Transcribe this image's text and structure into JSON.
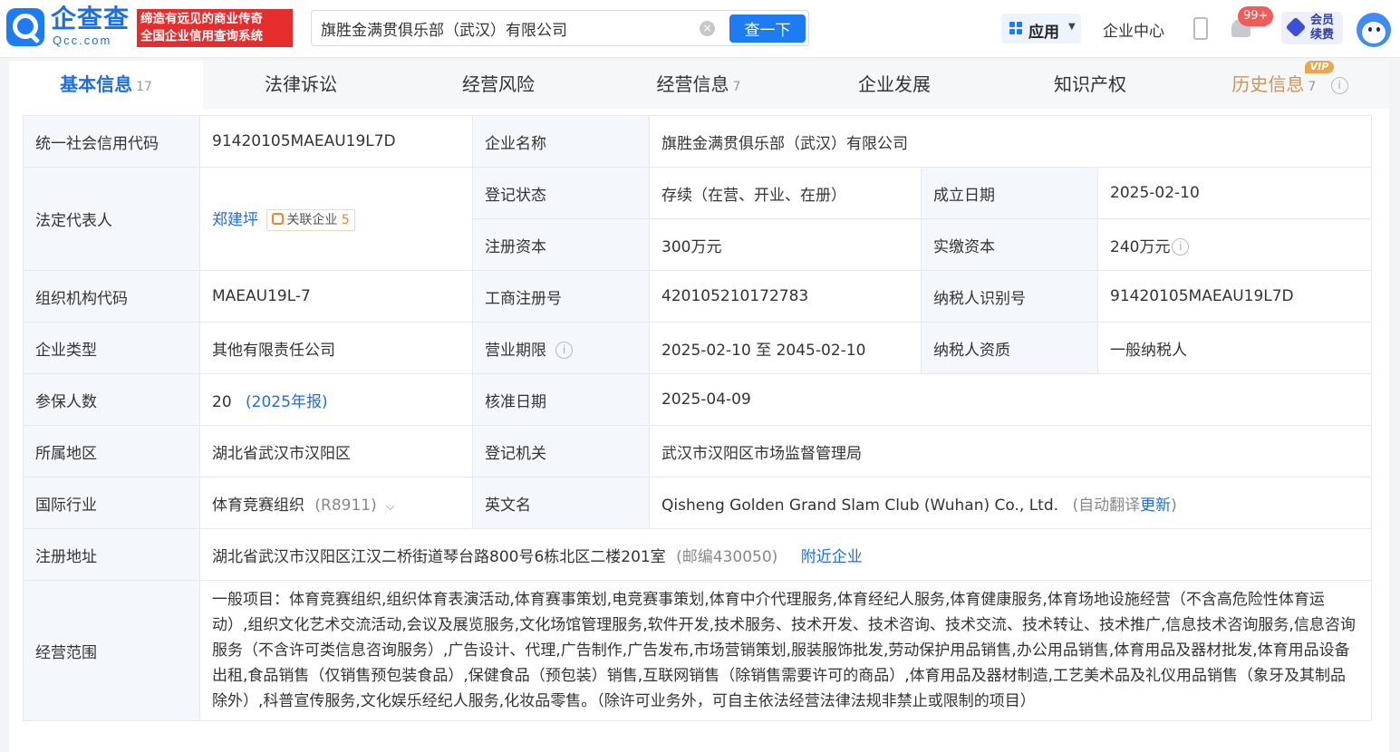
{
  "header": {
    "logo_text": "企查查",
    "logo_sub": "Qcc.com",
    "slogan_line1": "缔造有远见的商业传奇",
    "slogan_line2": "全国企业信用查询系统",
    "search_value": "旗胜金满贯俱乐部（武汉）有限公司",
    "search_button": "查一下",
    "app_menu": "应用",
    "enterprise_center": "企业中心",
    "notification_count": "99+",
    "vip_renew": "会员续费"
  },
  "tabs": [
    {
      "label": "基本信息",
      "count": "17"
    },
    {
      "label": "法律诉讼",
      "count": ""
    },
    {
      "label": "经营风险",
      "count": ""
    },
    {
      "label": "经营信息",
      "count": "7"
    },
    {
      "label": "企业发展",
      "count": ""
    },
    {
      "label": "知识产权",
      "count": ""
    },
    {
      "label": "历史信息",
      "count": "7",
      "tag": "VIP"
    }
  ],
  "info": {
    "credit_code_label": "统一社会信用代码",
    "credit_code": "91420105MAEAU19L7D",
    "company_name_label": "企业名称",
    "company_name": "旗胜金满贯俱乐部（武汉）有限公司",
    "legal_rep_label": "法定代表人",
    "legal_rep": "郑建坪",
    "related_label": "关联企业",
    "related_count": "5",
    "reg_status_label": "登记状态",
    "reg_status": "存续（在营、开业、在册）",
    "found_date_label": "成立日期",
    "found_date": "2025-02-10",
    "reg_capital_label": "注册资本",
    "reg_capital": "300万元",
    "paid_capital_label": "实缴资本",
    "paid_capital": "240万元",
    "org_code_label": "组织机构代码",
    "org_code": "MAEAU19L-7",
    "biz_reg_no_label": "工商注册号",
    "biz_reg_no": "420105210172783",
    "taxpayer_id_label": "纳税人识别号",
    "taxpayer_id": "91420105MAEAU19L7D",
    "ent_type_label": "企业类型",
    "ent_type": "其他有限责任公司",
    "term_label": "营业期限",
    "term": "2025-02-10 至 2045-02-10",
    "taxpayer_qual_label": "纳税人资质",
    "taxpayer_qual": "一般纳税人",
    "insured_label": "参保人数",
    "insured": "20",
    "insured_year": "(2025年报)",
    "approve_date_label": "核准日期",
    "approve_date": "2025-04-09",
    "region_label": "所属地区",
    "region": "湖北省武汉市汉阳区",
    "reg_authority_label": "登记机关",
    "reg_authority": "武汉市汉阳区市场监督管理局",
    "industry_label": "国际行业",
    "industry": "体育竞赛组织",
    "industry_code": "(R8911)",
    "en_name_label": "英文名",
    "en_name": "Qisheng Golden Grand Slam Club (Wuhan) Co., Ltd.",
    "en_name_note_prefix": "(自动翻译",
    "en_name_update": "更新",
    "en_name_note_suffix": ")",
    "address_label": "注册地址",
    "address": "湖北省武汉市汉阳区江汉二桥街道琴台路800号6栋北区二楼201室",
    "postcode": "(邮编430050)",
    "nearby": "附近企业",
    "scope_label": "经营范围",
    "scope": "一般项目：体育竞赛组织,组织体育表演活动,体育赛事策划,电竞赛事策划,体育中介代理服务,体育经纪人服务,体育健康服务,体育场地设施经营（不含高危险性体育运动）,组织文化艺术交流活动,会议及展览服务,文化场馆管理服务,软件开发,技术服务、技术开发、技术咨询、技术交流、技术转让、技术推广,信息技术咨询服务,信息咨询服务（不含许可类信息咨询服务）,广告设计、代理,广告制作,广告发布,市场营销策划,服装服饰批发,劳动保护用品销售,办公用品销售,体育用品及器材批发,体育用品设备出租,食品销售（仅销售预包装食品）,保健食品（预包装）销售,互联网销售（除销售需要许可的商品）,体育用品及器材制造,工艺美术品及礼仪用品销售（象牙及其制品除外）,科普宣传服务,文化娱乐经纪人服务,化妆品零售。（除许可业务外，可自主依法经营法律法规非禁止或限制的项目）"
  },
  "icons": {
    "info": "i",
    "clear": "×",
    "chevron": "⌵"
  },
  "colors": {
    "brand": "#1d7cf2",
    "slogan_bg": "#e42e2e",
    "vip": "#e8a84f",
    "history": "#c8955b"
  }
}
